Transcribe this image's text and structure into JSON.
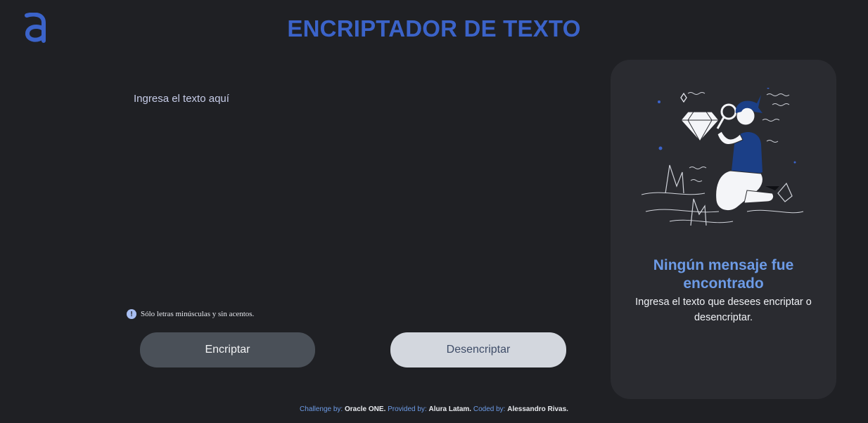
{
  "header": {
    "logo_icon": "alura-logo-icon",
    "title": "ENCRIPTADOR DE TEXTO"
  },
  "editor": {
    "placeholder": "Ingresa el texto aquí",
    "value": ""
  },
  "hint": {
    "icon": "info-icon",
    "text": "Sólo letras minúsculas y sin acentos."
  },
  "buttons": {
    "encrypt_label": "Encriptar",
    "decrypt_label": "Desencriptar"
  },
  "result_panel": {
    "illustration": "person-with-magnifying-glass-illustration",
    "title": "Ningún mensaje fue encontrado",
    "text": "Ingresa el texto que desees encriptar o desencriptar."
  },
  "footer": {
    "challenge_label": "Challenge by:",
    "challenge_value": "Oracle ONE",
    "provided_label": "Provided by:",
    "provided_value": "Alura Latam",
    "coded_label": "Coded by:",
    "coded_value": "Alessandro Rivas"
  },
  "colors": {
    "background": "#1f2024",
    "accent": "#3b63c9",
    "panel": "#2a2b30",
    "panel_title": "#6d9be6"
  }
}
